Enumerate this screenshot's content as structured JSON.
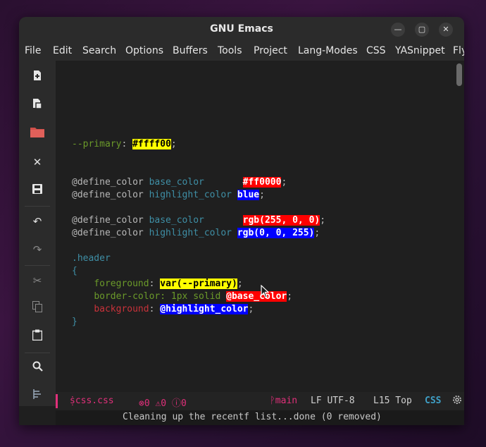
{
  "window": {
    "title": "GNU Emacs"
  },
  "window_buttons": {
    "minimize": "—",
    "maximize": "▢",
    "close": "✕"
  },
  "menu": [
    "File",
    "Edit",
    "Search",
    "Options",
    "Buffers",
    "Tools",
    "Project",
    "Lang-Modes",
    "CSS",
    "YASnippet",
    "Fly"
  ],
  "toolbar": {
    "icons": [
      "new-file-icon",
      "open-file-icon",
      "open-directory-icon",
      "close-buffer-icon",
      "save-icon",
      "undo-icon",
      "redo-icon",
      "cut-icon",
      "copy-icon",
      "paste-icon",
      "search-icon",
      "preferences-icon"
    ]
  },
  "code": {
    "l1_prop": "--primary",
    "l1_colon": ": ",
    "l1_val": "#ffff00",
    "semi": ";",
    "define": "@define_color",
    "base_color": "base_color",
    "highlight_color": "highlight_color",
    "red_hex": "#ff0000",
    "blue_word": "blue",
    "red_rgb": "rgb(255, 0, 0)",
    "blue_rgb": "rgb(0, 0, 255)",
    "selector": ".header",
    "open_brace": "{",
    "close_brace": "}",
    "fg_prop": "foreground",
    "fg_val": "var(--primary)",
    "border_prop": "border-color",
    "border_pre": ": 1px solid ",
    "border_val": "@base_color",
    "bg_prop": "background",
    "bg_val": "@highlight_color",
    "colon": ": "
  },
  "modeline": {
    "buffer_name": "ṩcss.css",
    "diagnostics": "⊗0 ⚠0 ⓘ0",
    "branch": "ᚹmain",
    "encoding": "LF UTF-8",
    "position": "L15 Top",
    "mode": "CSS"
  },
  "echo": {
    "message": "Cleaning up the recentf list...done (0 removed)"
  },
  "colors": {
    "yellow": "#ffff00",
    "red": "#ff0000",
    "blue": "#0000ff",
    "modeline_accent": "#e0307a"
  }
}
